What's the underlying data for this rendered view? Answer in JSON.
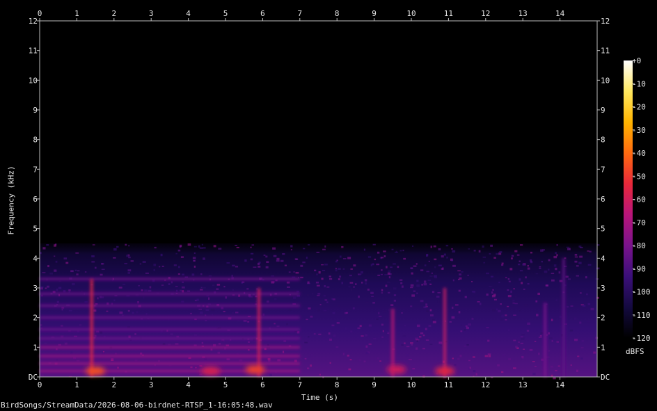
{
  "chart_data": {
    "type": "heatmap",
    "subtype": "spectrogram",
    "title": "",
    "caption": "BirdSongs/StreamData/2026-08-06-birdnet-RTSP_1-16:05:48.wav",
    "xlabel": "Time (s)",
    "ylabel": "Frequency (kHz)",
    "xlim": [
      0,
      15
    ],
    "ylim": [
      0,
      12
    ],
    "x_ticks": [
      "0",
      "1",
      "2",
      "3",
      "4",
      "5",
      "6",
      "7",
      "8",
      "9",
      "10",
      "11",
      "12",
      "13",
      "14"
    ],
    "y_ticks": [
      "DC",
      "1",
      "2",
      "3",
      "4",
      "5",
      "6",
      "7",
      "8",
      "9",
      "10",
      "11",
      "12"
    ],
    "colorbar": {
      "unit": "dBFS",
      "range": [
        -120,
        0
      ],
      "ticks": [
        "+0",
        "-10",
        "-20",
        "-30",
        "-40",
        "-50",
        "-60",
        "-70",
        "-80",
        "-90",
        "-100",
        "-110",
        "-120"
      ],
      "colormap": [
        "#000000",
        "#140a40",
        "#3b0f7a",
        "#7a138c",
        "#b8157a",
        "#e8283a",
        "#ff6a10",
        "#ffb400",
        "#ffe860",
        "#ffffff"
      ]
    },
    "energy_band_khz": [
      0,
      4.5
    ],
    "harmonic_bands_khz": [
      0.2,
      0.45,
      0.7,
      1.0,
      1.3,
      1.6,
      2.0,
      2.4,
      2.8,
      3.3
    ],
    "harmonic_end_s": 7.0,
    "transients": [
      {
        "t": 1.4,
        "top_khz": 3.3,
        "level_db": -55
      },
      {
        "t": 5.9,
        "top_khz": 3.0,
        "level_db": -60
      },
      {
        "t": 9.5,
        "top_khz": 2.3,
        "level_db": -65
      },
      {
        "t": 10.9,
        "top_khz": 3.0,
        "level_db": -62
      },
      {
        "t": 13.6,
        "top_khz": 2.5,
        "level_db": -80
      },
      {
        "t": 14.1,
        "top_khz": 4.0,
        "level_db": -85
      }
    ],
    "hot_spots": [
      {
        "t": 1.5,
        "f_khz": 0.15,
        "level_db": -45
      },
      {
        "t": 4.6,
        "f_khz": 0.15,
        "level_db": -58
      },
      {
        "t": 5.8,
        "f_khz": 0.2,
        "level_db": -48
      },
      {
        "t": 9.6,
        "f_khz": 0.2,
        "level_db": -60
      },
      {
        "t": 10.9,
        "f_khz": 0.15,
        "level_db": -55
      }
    ]
  }
}
